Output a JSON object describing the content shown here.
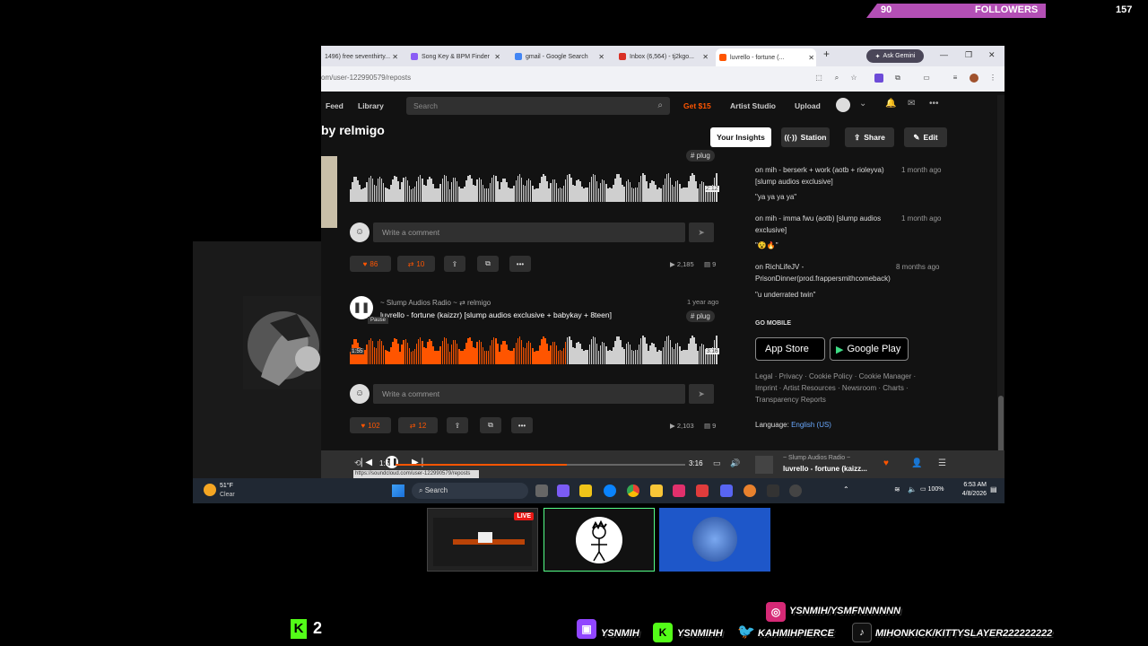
{
  "overlay": {
    "followers_count": "90",
    "followers_label": "FOLLOWERS",
    "followers_goal": "157",
    "kick_count": "2"
  },
  "browser": {
    "tabs": [
      {
        "label": "1496) free seventhirty...",
        "color": "#e33"
      },
      {
        "label": "Song Key & BPM Finder",
        "color": "#8a5cf5"
      },
      {
        "label": "gmail - Google Search",
        "color": "#4285f4"
      },
      {
        "label": "Inbox (6,564) - tj2kgo...",
        "color": "#d93025"
      },
      {
        "label": "luvrello - fortune (...",
        "color": "#f50"
      }
    ],
    "gemini_label": "Ask Gemini",
    "url": "om/user-122990579/reposts",
    "status_url": "https://soundcloud.com/user-122990579/reposts"
  },
  "soundcloud": {
    "nav": {
      "feed": "Feed",
      "library": "Library",
      "search_placeholder": "Search",
      "get": "Get $15",
      "artist_studio": "Artist Studio",
      "upload": "Upload"
    },
    "profile_title": "by relmigo",
    "buttons": {
      "insights": "Your Insights",
      "station": "Station",
      "share": "Share",
      "edit": "Edit"
    },
    "track1": {
      "tag": "# plug",
      "time": "2:12",
      "comment_placeholder": "Write a comment",
      "likes": "86",
      "reposts": "10",
      "plays": "2,185",
      "comments": "9"
    },
    "track2": {
      "user": "Slump Audios Radio",
      "reposter": "relmigo",
      "age": "1 year ago",
      "title": "luvrello - fortune (kaizzr) [slump audios exclusive + babykay + 8teen]",
      "tag": "# plug",
      "tooltip": "Pause",
      "elapsed": "1:55",
      "duration": "3:16",
      "comment_placeholder": "Write a comment",
      "likes": "102",
      "reposts": "12",
      "plays": "2,103",
      "comments": "9",
      "progress": 0.59
    },
    "sidebar": {
      "comments": [
        {
          "on": "on",
          "track": "mih - berserk + work (aotb + rioleyva) [slump audios exclusive]",
          "age": "1 month ago",
          "text": "\"ya ya ya ya\""
        },
        {
          "on": "on",
          "track": "mih - imma fwu (aotb) [slump audios exclusive]",
          "age": "1 month ago",
          "text": "\"😵🔥\""
        },
        {
          "on": "on",
          "track": "RichLifeJV - PrisonDinner(prod.frappersmithcomeback)",
          "age": "8 months ago",
          "text": "\"u underrated twin\""
        }
      ],
      "go_mobile": "GO MOBILE",
      "app_store": "App Store",
      "google_play": "Google Play",
      "footer_links": "Legal · Privacy · Cookie Policy · Cookie Manager · Imprint · Artist Resources · Newsroom · Charts · Transparency Reports",
      "language_label": "Language:",
      "language_value": "English (US)"
    },
    "player": {
      "elapsed": "1:55",
      "duration": "3:16",
      "progress": 0.59,
      "artist": "Slump Audios Radio",
      "title": "luvrello - fortune (kaizz..."
    }
  },
  "taskbar": {
    "weather_temp": "51°F",
    "weather_desc": "Clear",
    "search": "Search",
    "battery": "100%",
    "time": "6:53 AM",
    "date": "4/8/2026"
  },
  "thumbs": {
    "live_badge": "LIVE"
  },
  "socials": {
    "instagram": "YSNMIH/YSMFNNNNNN",
    "twitch": "YSNMIH",
    "kick": "YSNMIHH",
    "twitter": "KAHMIHPIERCE",
    "tiktok": "MIHONKICK/KITTYSLAYER222222222"
  },
  "colors": {
    "accent": "#ff5500",
    "followers_bar": "#b34fb5",
    "instagram": "#d62976",
    "twitch": "#9146ff",
    "kick": "#53fc18",
    "twitter": "#1d9bf0"
  }
}
